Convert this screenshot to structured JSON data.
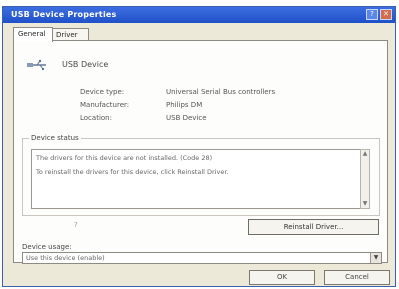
{
  "window": {
    "title": "USB Device Properties",
    "help_glyph": "?",
    "close_glyph": "✕"
  },
  "tabs": [
    {
      "label": "General"
    },
    {
      "label": "Driver"
    }
  ],
  "device": {
    "name": "USB Device",
    "icon": "usb-plug-icon",
    "properties": [
      {
        "label": "Device type:",
        "value": "Universal Serial Bus controllers"
      },
      {
        "label": "Manufacturer:",
        "value": "Philips DM"
      },
      {
        "label": "Location:",
        "value": "USB Device"
      }
    ]
  },
  "device_status": {
    "group_label": "Device status",
    "lines": [
      "The drivers for this device are not installed. (Code 28)",
      "To reinstall the drivers for this device, click Reinstall Driver."
    ],
    "reinstall_button": "Reinstall Driver..."
  },
  "device_usage": {
    "label": "Device usage:",
    "selected": "Use this device (enable)"
  },
  "footer": {
    "ok_label": "OK",
    "cancel_label": "Cancel"
  },
  "colors": {
    "titlebar": "#2050c8",
    "window_bg": "#ece9d8",
    "panel_bg": "#fdfdfb"
  }
}
